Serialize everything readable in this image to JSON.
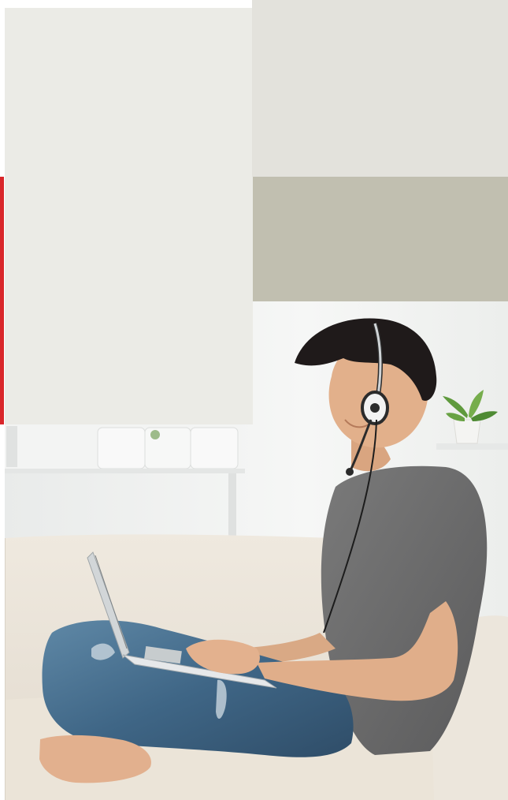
{
  "colors": {
    "accent": "#d9262a",
    "panel_light": "#ebebe6",
    "panel_mid": "#e3e2dc",
    "panel_taupe": "#c1bfb0"
  },
  "photo": {
    "subject": "man-with-headset-using-laptop-on-sofa"
  }
}
